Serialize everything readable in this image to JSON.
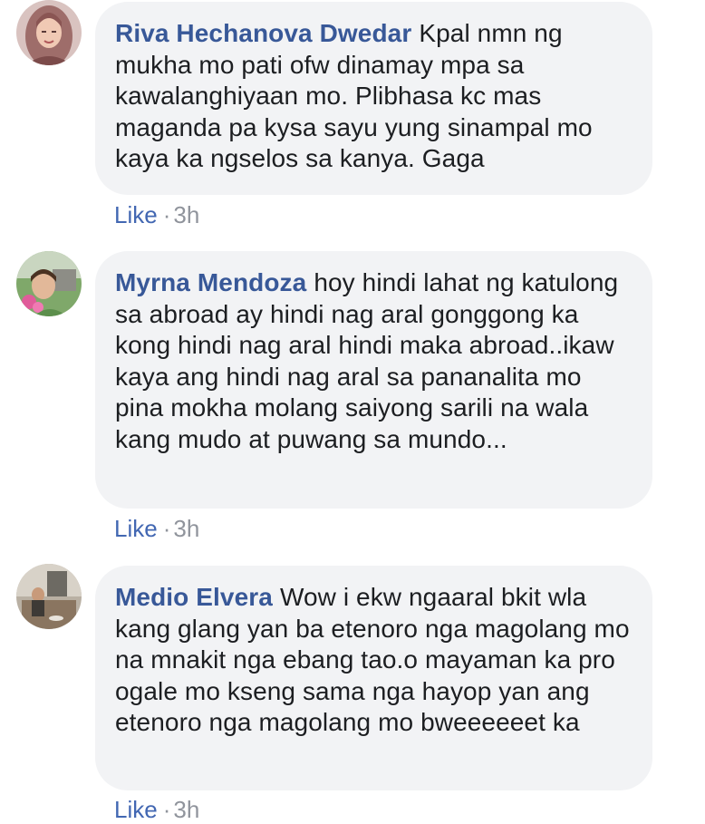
{
  "comments": [
    {
      "author": "Riva Hechanova Dwedar",
      "text": "Kpal nmn ng mukha mo pati ofw dinamay mpa sa kawalanghiyaan mo. Plibhasa kc mas maganda pa kysa sayu yung sinampal mo kaya ka ngselos sa kanya. Gaga",
      "like_label": "Like",
      "separator": "·",
      "time": "3h",
      "avatar_icon": "profile-photo-woman-hijab"
    },
    {
      "author": "Myrna Mendoza",
      "text": "hoy hindi lahat ng katulong sa abroad ay hindi nag aral gonggong ka kong hindi nag aral hindi maka abroad..ikaw kaya ang hindi nag aral sa pananalita mo pina mokha molang saiyong sarili na wala kang mudo at puwang sa mundo...",
      "like_label": "Like",
      "separator": "·",
      "time": "3h",
      "avatar_icon": "profile-photo-woman-flowers"
    },
    {
      "author": "Medio Elvera",
      "text": "Wow i ekw ngaaral bkit wla kang glang yan ba etenoro nga magolang mo na mnakit nga ebang tao.o mayaman ka pro ogale mo kseng sama nga hayop yan ang etenoro nga magolang mo bweeeeeet ka",
      "like_label": "Like",
      "separator": "·",
      "time": "3h",
      "avatar_icon": "profile-photo-room"
    }
  ],
  "colors": {
    "author_name": "#385898",
    "like_link": "#4267b2",
    "bubble_bg": "#f2f3f5",
    "body_text": "#1c1e21",
    "meta_text": "#90949c"
  }
}
